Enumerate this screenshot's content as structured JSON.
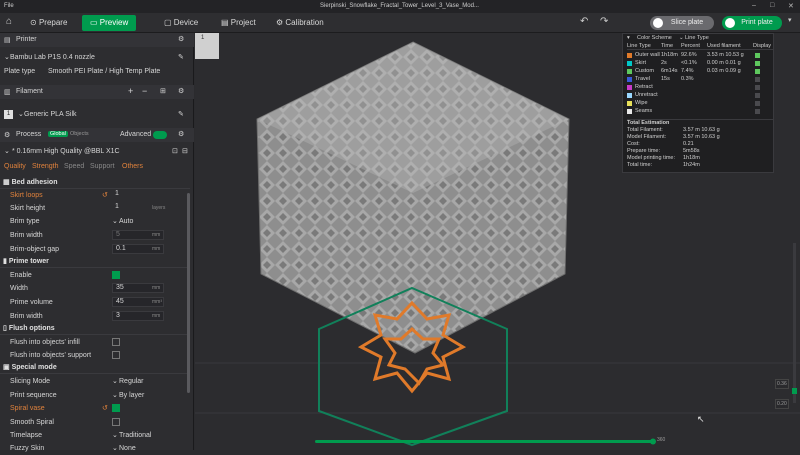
{
  "titlebar": {
    "file": "File",
    "title": "Sierpinski_Snowflake_Fractal_Tower_Level_3_Vase_Mod..."
  },
  "tabs": {
    "prepare": "Prepare",
    "preview": "Preview",
    "device": "Device",
    "project": "Project",
    "calibration": "Calibration"
  },
  "actions": {
    "slice": "Slice plate",
    "print": "Print plate"
  },
  "printer": {
    "title": "Printer",
    "name": "Bambu Lab P1S 0.4 nozzle",
    "plate_label": "Plate type",
    "plate_value": "Smooth PEI Plate / High Temp Plate"
  },
  "filament": {
    "title": "Filament",
    "index": "1",
    "name": "Generic PLA Silk"
  },
  "process": {
    "title": "Process",
    "global": "Global",
    "objects": "Objects",
    "advanced": "Advanced",
    "preset": "* 0.16mm High Quality @BBL X1C"
  },
  "ptabs": {
    "quality": "Quality",
    "strength": "Strength",
    "speed": "Speed",
    "support": "Support",
    "others": "Others"
  },
  "bed": {
    "title": "Bed adhesion",
    "skirt_loops": "Skirt loops",
    "skirt_loops_v": "1",
    "skirt_height": "Skirt height",
    "skirt_height_v": "1",
    "layers": "layers",
    "brim_type": "Brim type",
    "brim_type_v": "Auto",
    "brim_width": "Brim width",
    "brim_width_v": "5",
    "mm": "mm",
    "brim_gap": "Brim-object gap",
    "brim_gap_v": "0.1"
  },
  "prime": {
    "title": "Prime tower",
    "enable": "Enable",
    "width": "Width",
    "width_v": "35",
    "volume": "Prime volume",
    "volume_v": "45",
    "mm3": "mm³",
    "brim": "Brim width",
    "brim_v": "3"
  },
  "flush": {
    "title": "Flush options",
    "infill": "Flush into objects' infill",
    "support": "Flush into objects' support"
  },
  "special": {
    "title": "Special mode",
    "slicing": "Slicing Mode",
    "slicing_v": "Regular",
    "sequence": "Print sequence",
    "sequence_v": "By layer",
    "vase": "Spiral vase",
    "smooth": "Smooth Spiral",
    "timelapse": "Timelapse",
    "timelapse_v": "Traditional",
    "fuzzy": "Fuzzy Skin",
    "fuzzy_v": "None"
  },
  "legend": {
    "title": "Color Scheme",
    "scheme": "Line Type",
    "cols": [
      "Line Type",
      "Time",
      "Percent",
      "Used filament",
      "Display"
    ],
    "rows": [
      {
        "name": "Outer wall",
        "time": "1h18m",
        "pct": "92.6%",
        "used": "3.53 m  10.53 g",
        "color": "#e07a2a"
      },
      {
        "name": "Skirt",
        "time": "2s",
        "pct": "<0.1%",
        "used": "0.00 m  0.01 g",
        "color": "#00c8c8"
      },
      {
        "name": "Custom",
        "time": "6m14s",
        "pct": "7.4%",
        "used": "0.03 m  0.09 g",
        "color": "#5ec85e"
      },
      {
        "name": "Travel",
        "time": "15s",
        "pct": "0.3%",
        "used": "",
        "color": "#3a5ad8"
      },
      {
        "name": "Retract",
        "time": "",
        "pct": "",
        "used": "",
        "color": "#c83ac8"
      },
      {
        "name": "Unretract",
        "time": "",
        "pct": "",
        "used": "",
        "color": "#9ad8ff"
      },
      {
        "name": "Wipe",
        "time": "",
        "pct": "",
        "used": "",
        "color": "#e8e05a"
      },
      {
        "name": "Seams",
        "time": "",
        "pct": "",
        "used": "",
        "color": "#e8e8e8"
      }
    ],
    "est_title": "Total Estimation",
    "est": [
      {
        "k": "Total Filament:",
        "v": "3.57 m    10.63 g"
      },
      {
        "k": "Model Filament:",
        "v": "3.57 m    10.63 g"
      },
      {
        "k": "Cost:",
        "v": "0.21"
      },
      {
        "k": "Prepare time:",
        "v": "5m58s"
      },
      {
        "k": "Model printing time:",
        "v": "1h18m"
      },
      {
        "k": "Total time:",
        "v": "1h24m"
      }
    ]
  },
  "slider": {
    "top": "0.36",
    "bottom": "0.20",
    "layer": "360"
  },
  "plate_num": "1"
}
